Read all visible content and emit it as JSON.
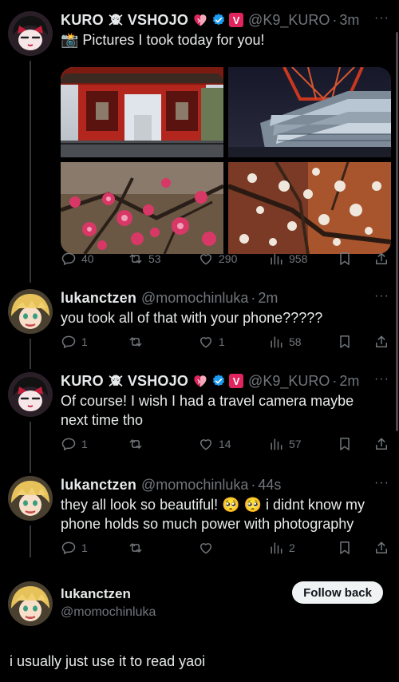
{
  "tweets": [
    {
      "display_name": "KURO",
      "name_suffix": "VSHOJO",
      "handle": "@K9_KURO",
      "time": "3m",
      "text": "📸 Pictures I took today for you!",
      "replies": "40",
      "reposts": "53",
      "likes": "290",
      "views": "958"
    },
    {
      "display_name": "lukanctzen",
      "handle": "@momochinluka",
      "time": "2m",
      "text": "you took all of that with your phone?????",
      "replies": "1",
      "reposts": "",
      "likes": "1",
      "views": "58"
    },
    {
      "display_name": "KURO",
      "name_suffix": "VSHOJO",
      "handle": "@K9_KURO",
      "time": "2m",
      "text": "Of course! I wish I had a travel camera maybe next time tho",
      "replies": "1",
      "reposts": "",
      "likes": "14",
      "views": "57"
    },
    {
      "display_name": "lukanctzen",
      "handle": "@momochinluka",
      "time": "44s",
      "text": "they all look so beautiful! 🥺 🥺  i didnt know my phone holds so much power with photography",
      "replies": "1",
      "reposts": "",
      "likes": "",
      "views": "2"
    }
  ],
  "profile_card": {
    "display_name": "lukanctzen",
    "handle": "@momochinluka",
    "follow_label": "Follow back",
    "bio": "i usually just use it to read yaoi"
  },
  "icons": {
    "reply": "reply-icon",
    "repost": "repost-icon",
    "like": "heart-icon",
    "views": "views-icon",
    "bookmark": "bookmark-icon",
    "share": "share-icon",
    "verified": "verified-badge-icon"
  },
  "colors": {
    "background": "#000000",
    "text": "#e7e9ea",
    "muted": "#71767b",
    "verified_blue": "#1d9bf0",
    "vshojo_pink": "#e0245e"
  }
}
